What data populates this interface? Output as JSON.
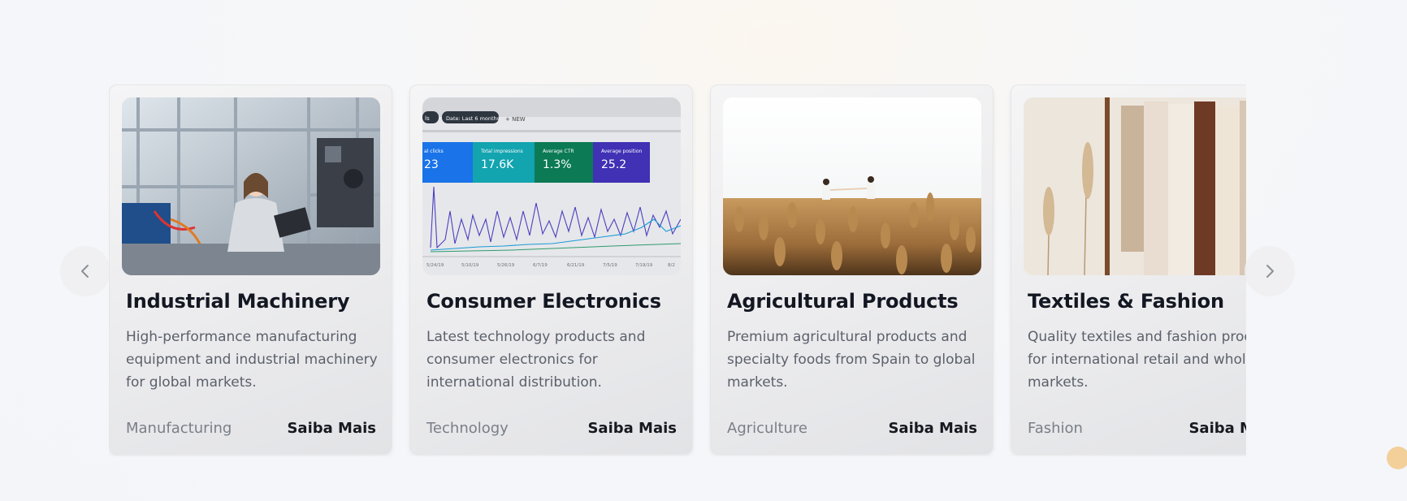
{
  "carousel": {
    "prev_icon": "chevron-left-icon",
    "next_icon": "chevron-right-icon",
    "cards": [
      {
        "image": "industrial-lab-photo",
        "title": "Industrial Machinery",
        "description": "High-performance manufacturing equipment and industrial machinery for global markets.",
        "category": "Manufacturing",
        "cta": "Saiba Mais"
      },
      {
        "image": "analytics-dashboard-photo",
        "title": "Consumer Electronics",
        "description": "Latest technology products and consumer electronics for international distribution.",
        "category": "Technology",
        "cta": "Saiba Mais",
        "dashboard": {
          "chip_left": "ls",
          "chip_date": "Date: Last 6 months",
          "chip_new": "+ NEW",
          "metrics": [
            {
              "label": "al clicks",
              "value": "23"
            },
            {
              "label": "Total impressions",
              "value": "17.6K"
            },
            {
              "label": "Average CTR",
              "value": "1.3%"
            },
            {
              "label": "Average position",
              "value": "25.2"
            }
          ],
          "dates": [
            "5/24/19",
            "5/10/19",
            "5/26/19",
            "6/7/19",
            "6/21/19",
            "7/5/19",
            "7/19/19",
            "8/2"
          ]
        }
      },
      {
        "image": "wheat-field-photo",
        "title": "Agricultural Products",
        "description": "Premium agricultural products and specialty foods from Spain to global markets.",
        "category": "Agriculture",
        "cta": "Saiba Mais"
      },
      {
        "image": "clothing-rack-photo",
        "title": "Textiles & Fashion",
        "description": "Quality textiles and fashion products for international retail and wholesale markets.",
        "category": "Fashion",
        "cta": "Saiba Mais"
      }
    ]
  },
  "colors": {
    "title": "#131722",
    "body": "#5b606b",
    "muted": "#7a7e87",
    "accent_dot": "#f3cf9a",
    "metric_blue": "#1a73e8",
    "metric_teal": "#12a4af",
    "metric_green": "#0b7a55",
    "metric_purple": "#4031b5"
  }
}
